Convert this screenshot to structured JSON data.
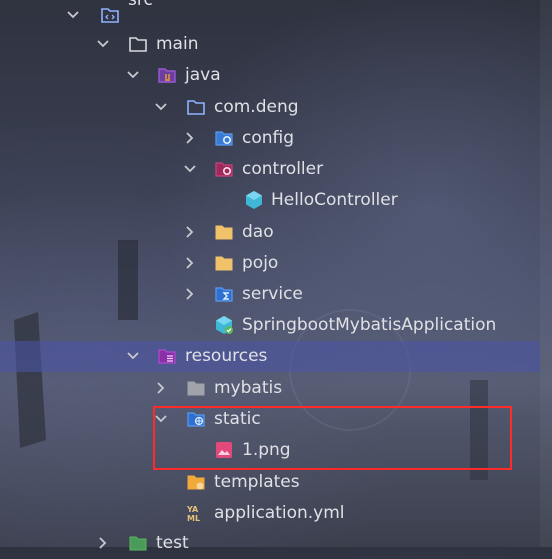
{
  "tree": {
    "src": "src",
    "main": "main",
    "java": "java",
    "package": "com.deng",
    "config": "config",
    "controller": "controller",
    "hello_controller": "HelloController",
    "dao": "dao",
    "pojo": "pojo",
    "service": "service",
    "application_class": "SpringbootMybatisApplication",
    "resources": "resources",
    "mybatis": "mybatis",
    "static": "static",
    "png_file": "1.png",
    "templates": "templates",
    "application_yml": "application.yml",
    "test": "test"
  },
  "icons": {
    "src": "source-folder-icon",
    "main": "folder-icon",
    "java": "java-source-root-icon",
    "package": "package-icon",
    "config": "config-package-icon",
    "controller": "controller-package-icon",
    "hello_controller": "spring-bean-class-icon",
    "dao": "folder-icon",
    "pojo": "folder-icon",
    "service": "service-package-icon",
    "application_class": "spring-boot-application-icon",
    "resources": "resources-root-icon",
    "mybatis": "folder-icon",
    "static": "web-folder-icon",
    "png_file": "image-file-icon",
    "templates": "templates-folder-icon",
    "application_yml": "yaml-file-icon",
    "test": "test-folder-icon"
  },
  "colors": {
    "selection": "#4a54aa",
    "highlight_border": "#ff2a2a",
    "text": "#dfe1e5",
    "folder_blue": "#8fb3ff",
    "folder_yellow": "#f0c36a",
    "java_purple": "#9b59d0",
    "resources_purple": "#b04acb",
    "spring_green": "#3fb8d8",
    "image_pink": "#e5497b"
  }
}
